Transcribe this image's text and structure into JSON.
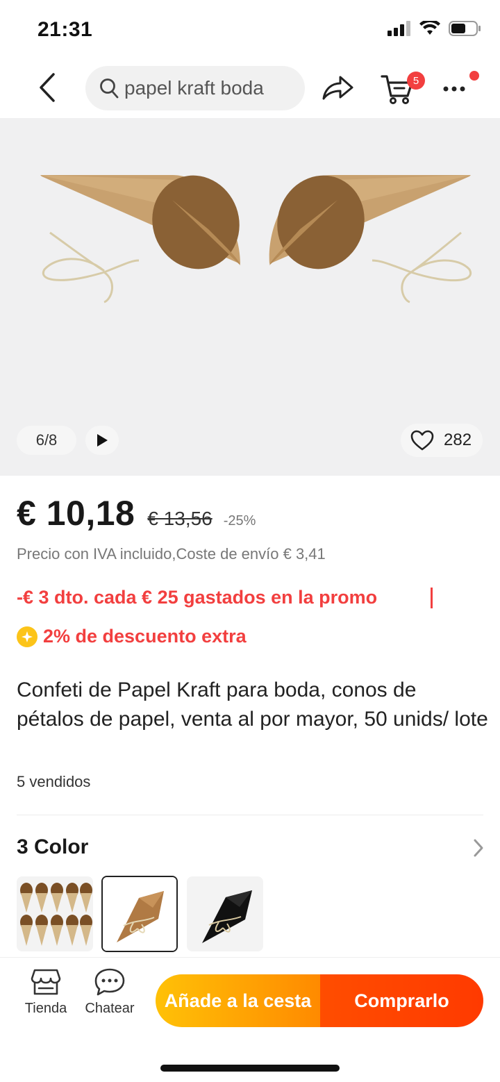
{
  "status_bar": {
    "time": "21:31"
  },
  "nav": {
    "search_query": "papel kraft boda",
    "cart_count": "5"
  },
  "gallery": {
    "counter": "6/8",
    "likes": "282"
  },
  "price": {
    "current": "€ 10,18",
    "original": "€ 13,56",
    "discount": "-25%",
    "tax_note": "Precio con IVA incluido,Coste de envío € 3,41"
  },
  "promos": {
    "store_promo": "-€ 3 dto. cada € 25 gastados en la promo",
    "extra_discount": "2% de descuento extra"
  },
  "product": {
    "title": "Confeti de Papel Kraft para boda, conos de pétalos de papel, venta al por mayor, 50 unids/ lote",
    "sold": "5 vendidos"
  },
  "colors": {
    "title": "3 Color",
    "selected_index": 1
  },
  "bottom_bar": {
    "store_label": "Tienda",
    "chat_label": "Chatear",
    "add_to_cart": "Añade a la cesta",
    "buy_now": "Comprarlo"
  },
  "theme": {
    "accent_red": "#f23f3f",
    "cart_gradient": [
      "#ffc107",
      "#ff8a00"
    ],
    "buy_color": "#ff4d00",
    "kraft": "#c69a67"
  },
  "icons": [
    "back-icon",
    "search-icon",
    "share-icon",
    "cart-icon",
    "more-icon",
    "play-icon",
    "heart-icon",
    "chevron-right-icon",
    "store-icon",
    "chat-icon",
    "sparkle-icon"
  ]
}
